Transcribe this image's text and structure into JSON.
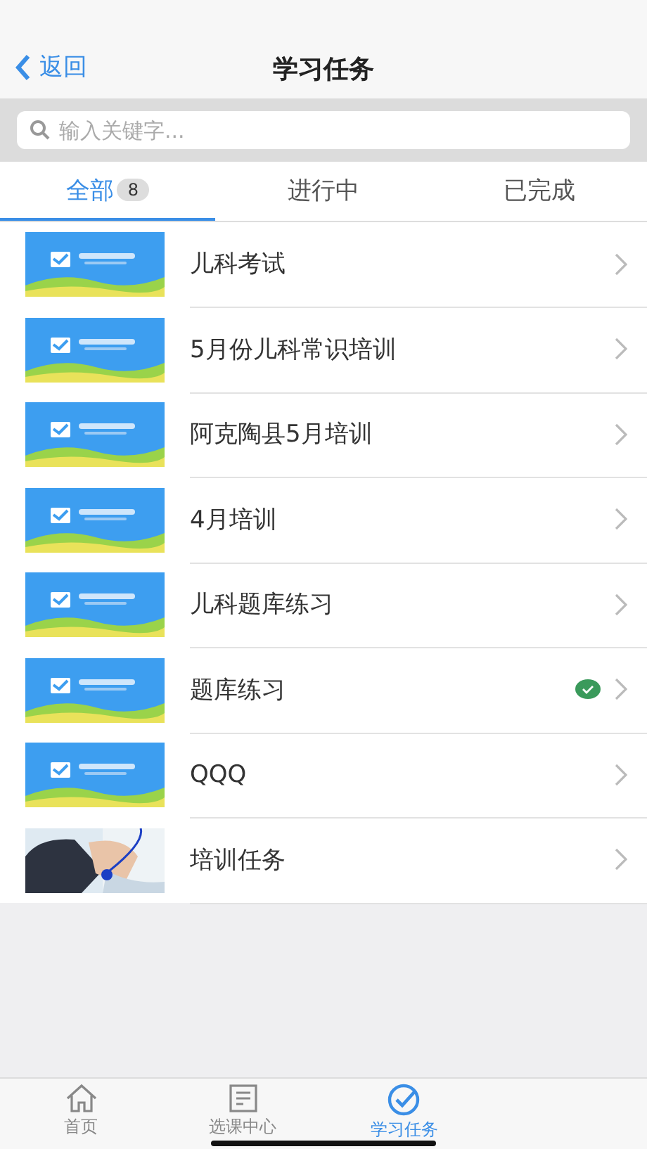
{
  "nav": {
    "back": "返回",
    "title": "学习任务"
  },
  "search": {
    "placeholder": "输入关键字..."
  },
  "tabs": [
    {
      "label": "全部",
      "count": "8",
      "selected": true
    },
    {
      "label": "进行中",
      "selected": false
    },
    {
      "label": "已完成",
      "selected": false
    }
  ],
  "tasks": [
    {
      "title": "儿科考试",
      "kind": "banner",
      "completed": false
    },
    {
      "title": "5月份儿科常识培训",
      "kind": "banner",
      "completed": false
    },
    {
      "title": "阿克陶县5月培训",
      "kind": "banner",
      "completed": false
    },
    {
      "title": "4月培训",
      "kind": "banner",
      "completed": false
    },
    {
      "title": "儿科题库练习",
      "kind": "banner",
      "completed": false
    },
    {
      "title": "题库练习",
      "kind": "banner",
      "completed": true
    },
    {
      "title": "QQQ",
      "kind": "banner",
      "completed": false
    },
    {
      "title": "培训任务",
      "completed": false
    }
  ],
  "tab_bar": [
    {
      "label": "首页",
      "selected": false
    },
    {
      "label": "选课中心",
      "selected": false
    },
    {
      "label": "学习任务",
      "selected": true
    }
  ]
}
